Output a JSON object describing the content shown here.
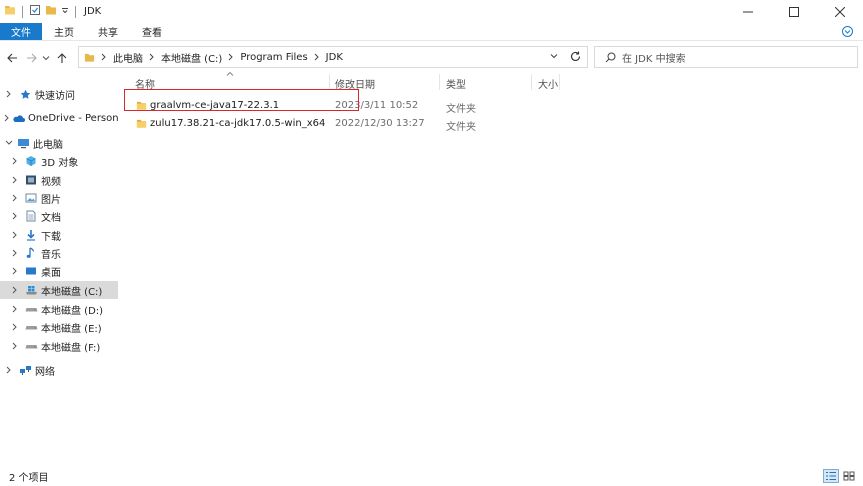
{
  "window": {
    "title": "JDK",
    "controls": [
      "minimize-icon",
      "maximize-icon",
      "close-icon"
    ]
  },
  "ribbon": {
    "tabs": [
      {
        "label": "文件"
      },
      {
        "label": "主页"
      },
      {
        "label": "共享"
      },
      {
        "label": "查看"
      }
    ]
  },
  "address": {
    "breadcrumbs": [
      "此电脑",
      "本地磁盘 (C:)",
      "Program Files",
      "JDK"
    ]
  },
  "search": {
    "placeholder": "在 JDK 中搜索"
  },
  "navpane": {
    "items": [
      {
        "label": "快速访问",
        "icon": "quick-access-star-icon",
        "level": 0
      },
      {
        "label": "OneDrive - Personal",
        "icon": "onedrive-cloud-icon",
        "level": 0
      },
      {
        "label": "此电脑",
        "icon": "this-pc-icon",
        "level": 0,
        "expanded": true
      },
      {
        "label": "3D 对象",
        "icon": "3d-objects-icon",
        "level": 1
      },
      {
        "label": "视频",
        "icon": "videos-icon",
        "level": 1
      },
      {
        "label": "图片",
        "icon": "pictures-icon",
        "level": 1
      },
      {
        "label": "文档",
        "icon": "documents-icon",
        "level": 1
      },
      {
        "label": "下载",
        "icon": "downloads-icon",
        "level": 1
      },
      {
        "label": "音乐",
        "icon": "music-icon",
        "level": 1
      },
      {
        "label": "桌面",
        "icon": "desktop-icon",
        "level": 1
      },
      {
        "label": "本地磁盘 (C:)",
        "icon": "system-drive-icon",
        "level": 1,
        "selected": true
      },
      {
        "label": "本地磁盘 (D:)",
        "icon": "drive-icon",
        "level": 1
      },
      {
        "label": "本地磁盘 (E:)",
        "icon": "drive-icon",
        "level": 1
      },
      {
        "label": "本地磁盘 (F:)",
        "icon": "drive-icon",
        "level": 1
      },
      {
        "label": "网络",
        "icon": "network-icon",
        "level": 0
      }
    ]
  },
  "columns": {
    "name": "名称",
    "modified": "修改日期",
    "type": "类型",
    "size": "大小"
  },
  "files": [
    {
      "name": "graalvm-ce-java17-22.3.1",
      "modified": "2023/3/11 10:52",
      "type": "文件夹",
      "size": "",
      "highlighted": true
    },
    {
      "name": "zulu17.38.21-ca-jdk17.0.5-win_x64",
      "modified": "2022/12/30 13:27",
      "type": "文件夹",
      "size": ""
    }
  ],
  "status": {
    "item_count": "2 个项目"
  },
  "colors": {
    "accent": "#1979ca",
    "highlight_box": "#d9272e",
    "folder": "#e8b94a",
    "selected_bg": "#dadada"
  }
}
